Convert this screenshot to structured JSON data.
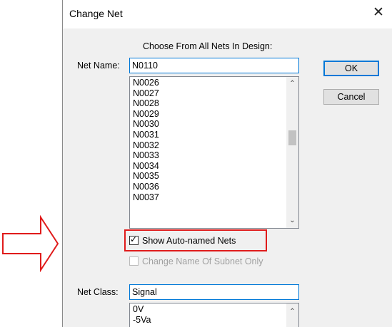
{
  "dialog": {
    "title": "Change Net",
    "close_glyph": "✕",
    "choose_label": "Choose From All Nets In Design:",
    "net_name_label": "Net Name:",
    "net_name_value": "N0110",
    "net_list": [
      "N0026",
      "N0027",
      "N0028",
      "N0029",
      "N0030",
      "N0031",
      "N0032",
      "N0033",
      "N0034",
      "N0035",
      "N0036",
      "N0037"
    ],
    "ok_label": "OK",
    "cancel_label": "Cancel",
    "show_auto_named_label": "Show Auto-named Nets",
    "show_auto_named_checked": true,
    "change_subnet_label": "Change Name Of Subnet  Only",
    "net_class_label": "Net Class:",
    "net_class_value": "Signal",
    "net_class_list": [
      "0V",
      "-5Va"
    ]
  },
  "colors": {
    "annotation": "#e01b1b",
    "focus_border": "#0078d7"
  }
}
